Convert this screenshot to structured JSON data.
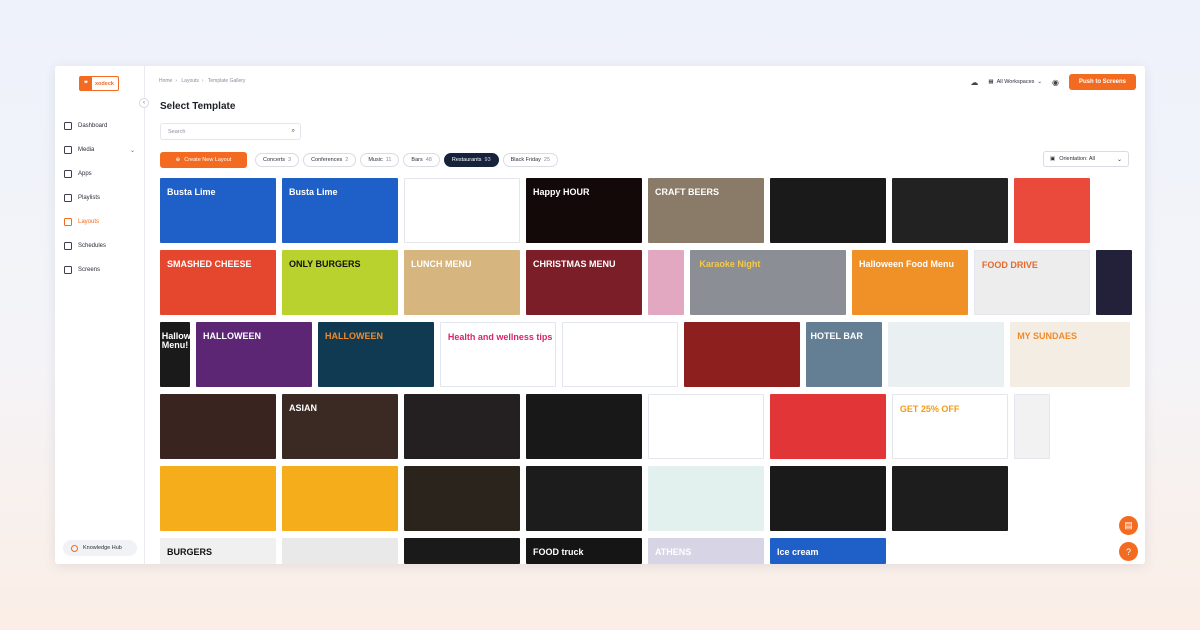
{
  "brand": {
    "logo_text": "xodeck"
  },
  "sidebar": {
    "items": [
      {
        "label": "Dashboard",
        "icon": "dashboard-icon"
      },
      {
        "label": "Media",
        "icon": "media-icon"
      },
      {
        "label": "Apps",
        "icon": "apps-icon"
      },
      {
        "label": "Playlists",
        "icon": "playlists-icon"
      },
      {
        "label": "Layouts",
        "icon": "layouts-icon"
      },
      {
        "label": "Schedules",
        "icon": "schedules-icon"
      },
      {
        "label": "Screens",
        "icon": "screens-icon"
      }
    ],
    "knowledge_hub": "Knowledge Hub"
  },
  "breadcrumb": {
    "home": "Home",
    "layouts": "Layouts",
    "current": "Template Gallery"
  },
  "header": {
    "workspaces": "All Workspaces",
    "push_button": "Push to Screens"
  },
  "page": {
    "title": "Select Template",
    "search_placeholder": "Search"
  },
  "filters": {
    "create_label": "Create New Layout",
    "chips": [
      {
        "label": "Concerts",
        "count": "3"
      },
      {
        "label": "Conferences",
        "count": "2"
      },
      {
        "label": "Music",
        "count": "11"
      },
      {
        "label": "Bars",
        "count": "48"
      },
      {
        "label": "Restaurants",
        "count": "93"
      },
      {
        "label": "Black Friday",
        "count": "25"
      }
    ],
    "orientation": "Orientation: All"
  },
  "tiles": [
    {
      "label": "Busta Lime"
    },
    {
      "label": "Busta Lime"
    },
    {
      "label": ""
    },
    {
      "label": "Happy HOUR"
    },
    {
      "label": "CRAFT BEERS"
    },
    {
      "label": ""
    },
    {
      "label": ""
    },
    {
      "label": ""
    },
    {
      "label": "SMASHED CHEESE"
    },
    {
      "label": "ONLY BURGERS"
    },
    {
      "label": "LUNCH MENU"
    },
    {
      "label": "CHRISTMAS MENU"
    },
    {
      "label": ""
    },
    {
      "label": "Karaoke Night"
    },
    {
      "label": "Halloween Food Menu"
    },
    {
      "label": "FOOD DRIVE"
    },
    {
      "label": ""
    },
    {
      "label": "Halloween Menu!"
    },
    {
      "label": "HALLOWEEN"
    },
    {
      "label": "HALLOWEEN"
    },
    {
      "label": "Health and wellness tips"
    },
    {
      "label": ""
    },
    {
      "label": ""
    },
    {
      "label": "HOTEL BAR"
    },
    {
      "label": ""
    },
    {
      "label": "MY SUNDAES"
    },
    {
      "label": ""
    },
    {
      "label": "ASIAN"
    },
    {
      "label": ""
    },
    {
      "label": ""
    },
    {
      "label": ""
    },
    {
      "label": ""
    },
    {
      "label": "GET 25% OFF"
    },
    {
      "label": ""
    },
    {
      "label": ""
    },
    {
      "label": ""
    },
    {
      "label": ""
    },
    {
      "label": ""
    },
    {
      "label": ""
    },
    {
      "label": ""
    },
    {
      "label": ""
    },
    {
      "label": "BURGERS"
    },
    {
      "label": ""
    },
    {
      "label": ""
    },
    {
      "label": "FOOD truck"
    },
    {
      "label": "ATHENS"
    },
    {
      "label": "Ice cream"
    }
  ],
  "colors": {
    "accent": "#f26b21",
    "active_chip": "#17233b"
  }
}
